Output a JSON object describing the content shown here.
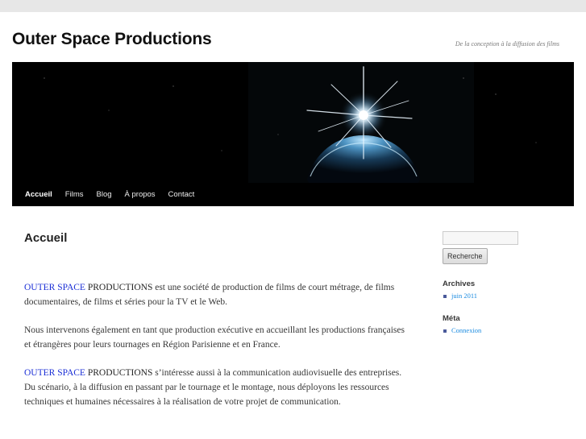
{
  "site": {
    "title": "Outer Space Productions",
    "tagline": "De la conception à la diffusion des films"
  },
  "nav": {
    "items": [
      {
        "label": "Accueil"
      },
      {
        "label": "Films"
      },
      {
        "label": "Blog"
      },
      {
        "label": "À propos"
      },
      {
        "label": "Contact"
      }
    ]
  },
  "main": {
    "title": "Accueil",
    "paragraphs": [
      {
        "brand_a": "OUTER SPACE",
        "brand_b": "PRODUCTIONS",
        "text": " est une société de production de films de court métrage, de films documentaires, de films et séries pour la TV et le Web."
      },
      {
        "text": "Nous intervenons également en tant que production exécutive en accueillant les productions françaises et étrangères pour leurs tournages en Région Parisienne et en France."
      },
      {
        "brand_a": "OUTER SPACE",
        "brand_b": "PRODUCTIONS",
        "text": " s’intéresse aussi à la communication audiovisuelle des entreprises. Du scénario, à la diffusion en passant par le tournage et le montage, nous déployons les ressources techniques et humaines nécessaires à la réalisation de votre projet de communication."
      }
    ]
  },
  "sidebar": {
    "search": {
      "placeholder": "",
      "button_label": "Recherche"
    },
    "archives": {
      "title": "Archives",
      "items": [
        {
          "label": "juin 2011"
        }
      ]
    },
    "meta": {
      "title": "Méta",
      "items": [
        {
          "label": "Connexion"
        }
      ]
    }
  },
  "colors": {
    "brand_blue": "#1b2fd6",
    "link_blue": "#1b8be0",
    "banner_bg": "#000000"
  }
}
